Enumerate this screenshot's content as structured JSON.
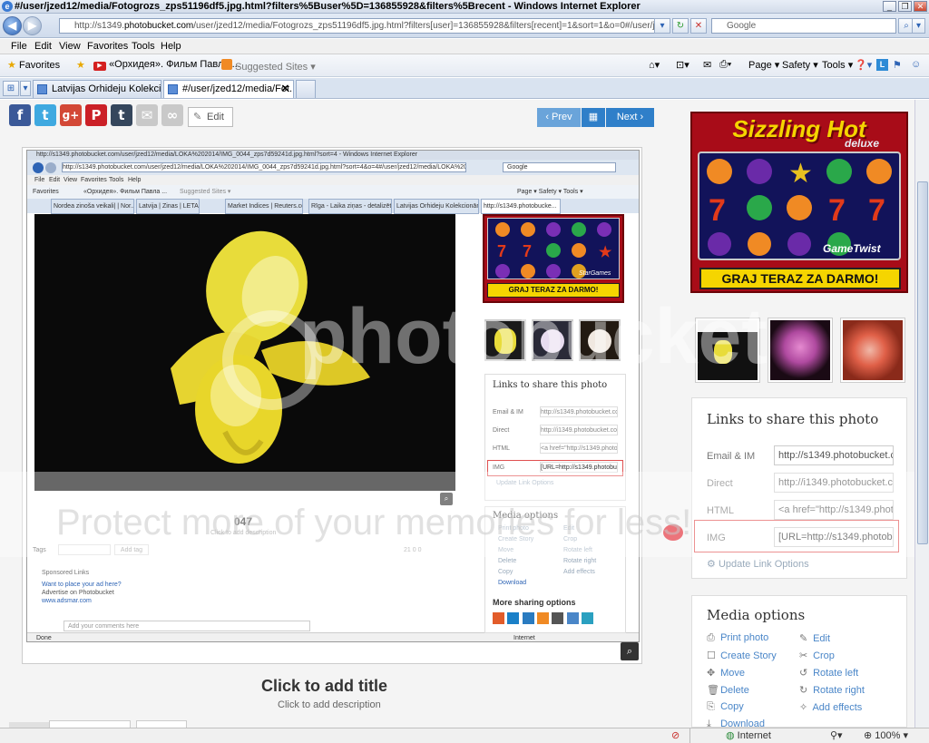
{
  "window": {
    "title": "#/user/jzed12/media/Fotogrozs_zps51196df5.jpg.html?filters%5Buser%5D=136855928&filters%5Brecent",
    "title_suffix": " - Windows Internet Explorer"
  },
  "address": {
    "prefix": "http://s1349.",
    "host": "photobucket.com",
    "path": "/user/jzed12/media/Fotogrozs_zps51196df5.jpg.html?filters[user]=136855928&filters[recent]=1&sort=1&o=0#/user/jzed12/media/Fo",
    "search_placeholder": "Google"
  },
  "menu": [
    "File",
    "Edit",
    "View",
    "Favorites",
    "Tools",
    "Help"
  ],
  "favorites_bar": {
    "favorites_label": "Favorites",
    "link1": "«Орхидея». Фильм Павла ...",
    "link2": "Suggested Sites ▾",
    "cmd_page": "Page ▾",
    "cmd_safety": "Safety ▾",
    "cmd_tools": "Tools ▾"
  },
  "tabs": [
    {
      "label": "Latvijas Orhideju Kolekcionār..."
    },
    {
      "label": "#/user/jzed12/media/Fot..."
    }
  ],
  "toolbar": {
    "edit_label": "Edit",
    "prev_label": "‹ Prev",
    "next_label": "Next ›"
  },
  "social": [
    "f",
    "t",
    "g+",
    "P",
    "t",
    "✉",
    "∞"
  ],
  "inner_browser": {
    "title": "http://s1349.photobucket.com/user/jzed12/media/LOKA%202014/IMG_0044_zps7d59241d.jpg.html?sort=4 - Windows Internet Explorer",
    "address": "http://s1349.photobucket.com/user/jzed12/media/LOKA%202014/IMG_0044_zps7d59241d.jpg.html?sort=4&o=4#/user/jzed12/media/LOKA%202014/IMG_0044_zps7",
    "search": "Google",
    "menu": [
      "File",
      "Edit",
      "View",
      "Favorites",
      "Tools",
      "Help"
    ],
    "fav_items": [
      "Favorites",
      "«Орхидея». Фильм Павла ...",
      "Suggested Sites ▾"
    ],
    "cmds": "Page ▾  Safety ▾  Tools ▾",
    "tabs": [
      "Nordea zinoša veikali| | Nor...",
      "Latvija | Zinas | LETA",
      "Market Indices | Reuters.com",
      "Rīga - Laika ziņas - detalizēt...",
      "Latvijas Orhideju Kolekcionār...",
      "http://s1349.photobucke..."
    ],
    "photo_title": "047",
    "photo_desc": "Click to add description",
    "tags_label": "Tags",
    "add_tag": "Add tag",
    "counts": "21  0  0",
    "sponsored": "Sponsored Links",
    "ad_line1": "Want to place your ad here?",
    "ad_line2": "Advertise on Photobucket",
    "ad_line3": "www.adsmar.com",
    "comment_placeholder": "Add your comments here",
    "share_title": "Links to share this photo",
    "share_rows": [
      {
        "label": "Email & IM",
        "value": "http://s1349.photobucket.co"
      },
      {
        "label": "Direct",
        "value": "http://i1349.photobucket.com"
      },
      {
        "label": "HTML",
        "value": "<a href=\"http://s1349.photo"
      },
      {
        "label": "IMG",
        "value": "[URL=http://s1349.photobuc"
      }
    ],
    "update_link": "Update Link Options",
    "media_title": "Media options",
    "media_items": [
      "Print photo",
      "Edit",
      "Create Story",
      "Crop",
      "Move",
      "Rotate left",
      "Delete",
      "Rotate right",
      "Copy",
      "Add effects",
      "Download"
    ],
    "more_sharing": "More sharing options",
    "ad_button": "GRAJ TERAZ ZA DARMO!",
    "ad_brand": "StarGames",
    "status_done": "Done",
    "status_zone": "Internet"
  },
  "main": {
    "title_placeholder": "Click to add title",
    "desc_placeholder": "Click to add description"
  },
  "ad": {
    "headline": "Sizzling Hot",
    "headline_sub": "deluxe",
    "brand": "GameTwist",
    "cta": "GRAJ TERAZ ZA DARMO!"
  },
  "share": {
    "title": "Links to share this photo",
    "rows": [
      {
        "label": "Email & IM",
        "value": "http://s1349.photobucket.co"
      },
      {
        "label": "Direct",
        "value": "http://i1349.photobucket.co"
      },
      {
        "label": "HTML",
        "value": "<a href=\"http://s1349.photo"
      },
      {
        "label": "IMG",
        "value": "[URL=http://s1349.photobuc"
      }
    ],
    "update_link": "Update Link Options"
  },
  "media": {
    "title": "Media options",
    "left": [
      "Print photo",
      "Create Story",
      "Move",
      "Delete",
      "Copy",
      "Download"
    ],
    "right": [
      "Edit",
      "Crop",
      "Rotate left",
      "Rotate right",
      "Add effects"
    ]
  },
  "watermark": {
    "line1": "photobucket",
    "line2": "Protect more of your memories for less!"
  },
  "status": {
    "zone": "Internet",
    "zoom": "100%"
  },
  "colors": {
    "accent": "#2f7fc9",
    "link": "#4a86c8",
    "ad_red": "#a80c18"
  }
}
